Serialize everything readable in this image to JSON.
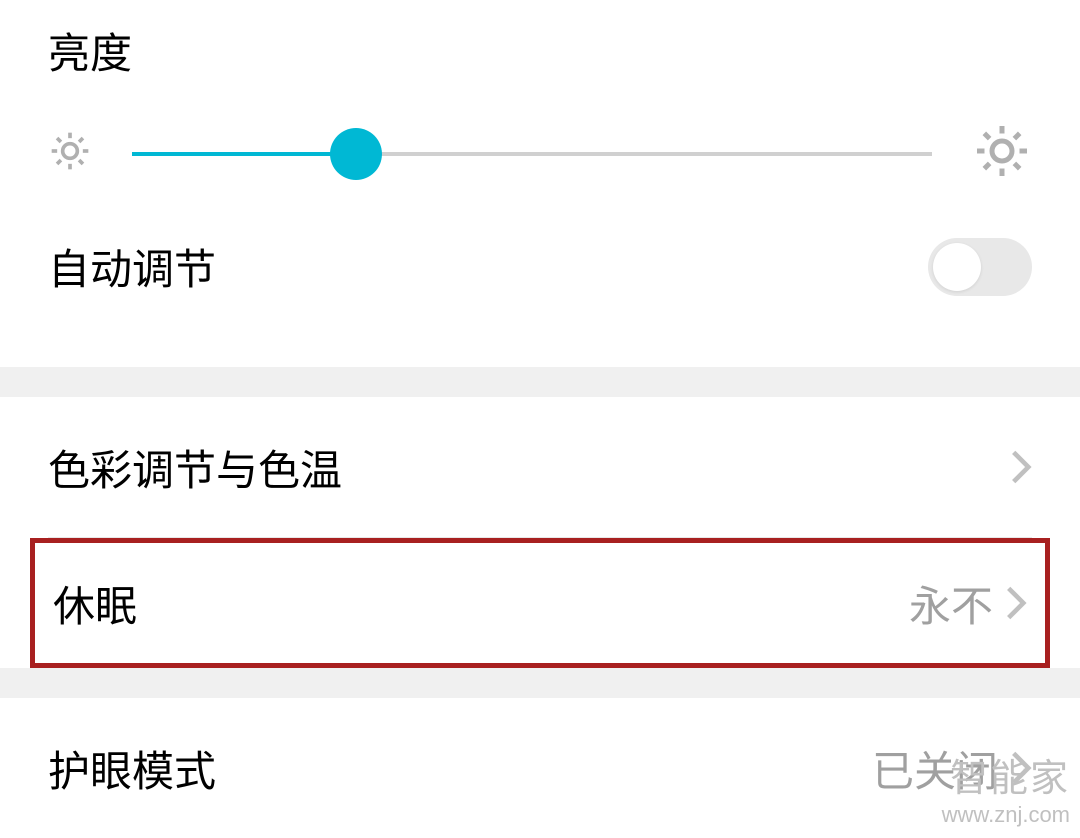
{
  "brightness": {
    "title": "亮度",
    "slider_percent": 28
  },
  "auto_adjust": {
    "label": "自动调节",
    "enabled": false
  },
  "color_temp": {
    "label": "色彩调节与色温"
  },
  "sleep": {
    "label": "休眠",
    "value": "永不"
  },
  "eye_protect": {
    "label": "护眼模式",
    "value": "已关闭"
  },
  "watermark": {
    "title": "智能家",
    "url": "www.znj.com"
  }
}
